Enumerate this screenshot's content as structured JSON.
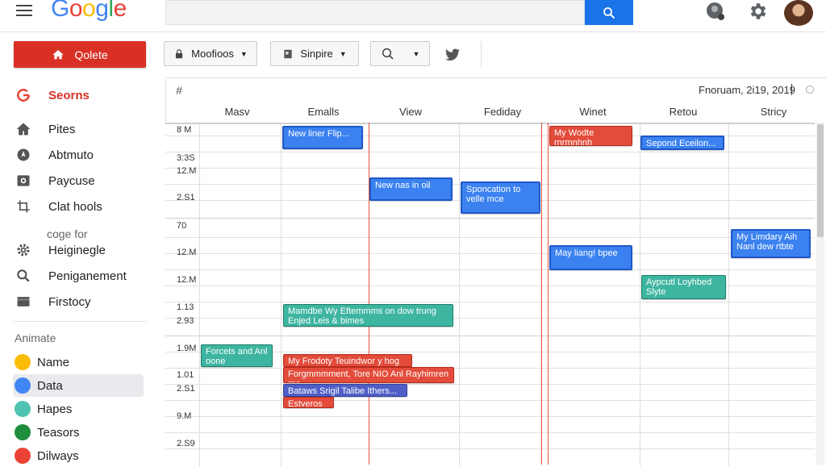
{
  "colors": {
    "primary_red": "#d93025",
    "blue": "#3b82f0",
    "teal": "#3eb5a0",
    "red": "#e34b3a",
    "indigo": "#4f5fc7"
  },
  "header": {
    "logo": [
      "G",
      "o",
      "o",
      "g",
      "l",
      "e"
    ],
    "logo_colors": [
      "#4285f4",
      "#ea4335",
      "#fbbc05",
      "#4285f4",
      "#34a853",
      "#ea4335"
    ]
  },
  "toolbar": {
    "primary_label": "Qolete",
    "btn1_label": "Moofioos",
    "btn2_label": "Sinpire"
  },
  "sidebar": {
    "items": [
      {
        "label": "Seorns",
        "icon": "google-g-icon"
      },
      {
        "label": "Pites",
        "icon": "home-icon"
      },
      {
        "label": "Abtmuto",
        "icon": "compass-icon"
      },
      {
        "label": "Paycuse",
        "icon": "camera-icon"
      },
      {
        "label": "Clat hools",
        "icon": "crop-icon"
      }
    ],
    "subheading": "coge for",
    "items2": [
      {
        "label": "Heiginegle",
        "icon": "gear-icon"
      },
      {
        "label": "Peniganement",
        "icon": "search-icon"
      },
      {
        "label": "Firstocy",
        "icon": "folder-icon"
      }
    ],
    "section_title": "Animate",
    "calendars": [
      {
        "label": "Name",
        "color": "#fbbc05"
      },
      {
        "label": "Data",
        "color": "#4285f4"
      },
      {
        "label": "Hapes",
        "color": "#4fc3b1"
      },
      {
        "label": "Teasors",
        "color": "#1e8e3e"
      },
      {
        "label": "Dilways",
        "color": "#ea4335"
      }
    ]
  },
  "calendar": {
    "hash": "#",
    "date_label": "Fnoruam, 2i19, 2019",
    "columns": [
      "Masv",
      "Emalls",
      "View",
      "Fediday",
      "Winet",
      "Retou",
      "Stricy"
    ],
    "times": [
      "8 M",
      "3:3S",
      "12.M",
      "2.S1",
      "70",
      "12.M",
      "12.M",
      "1.13",
      "2.93",
      "1.9M",
      "1.01",
      "2.S1",
      "9.M",
      "2.S9"
    ],
    "events": [
      {
        "text": "New liner Flip...",
        "color": "blue"
      },
      {
        "text": "My Wodte rnrmnhnh",
        "color": "red"
      },
      {
        "text": "Sepond Eceilon...",
        "color": "blue"
      },
      {
        "text": "New nas in oil",
        "color": "blue"
      },
      {
        "text": "Sponcation to velle mce",
        "color": "blue"
      },
      {
        "text": "My Limdary Aih Nanl dew rtbte",
        "color": "blue"
      },
      {
        "text": "May liang! bpee",
        "color": "blue"
      },
      {
        "text": "Aypcutl Loyhbed Slyte",
        "color": "teal"
      },
      {
        "text": "Mamdbe Wy Eftemmms on dow trung Enjed Leis & bimes",
        "color": "teal"
      },
      {
        "text": "Forcets and Anl oone",
        "color": "teal"
      },
      {
        "text": "My Frodoty Teuindwor y hog",
        "color": "red"
      },
      {
        "text": "Forgmmmment, Tore NIO Anl Rayhimren rne",
        "color": "red"
      },
      {
        "text": "Bataws Srigil Talibe Ithers...",
        "color": "indigo"
      },
      {
        "text": "Estveros",
        "color": "red"
      }
    ]
  }
}
